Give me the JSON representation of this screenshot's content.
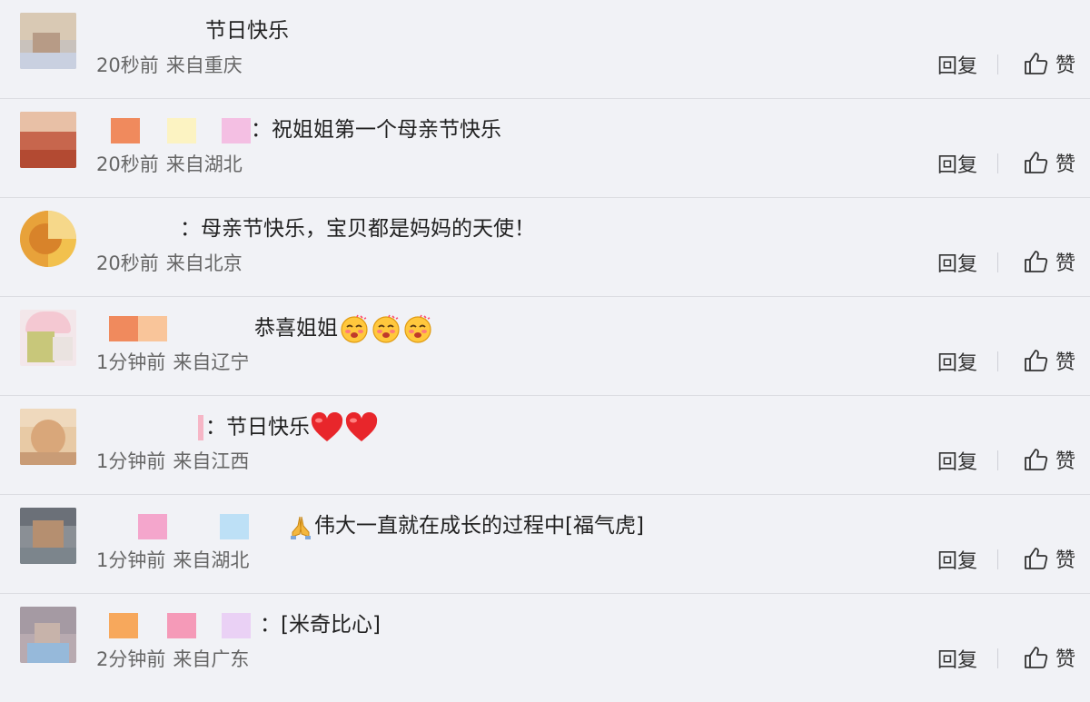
{
  "actions": {
    "reply_label": "回复",
    "like_label": "赞"
  },
  "comments": [
    {
      "text": "节日快乐",
      "time": "20秒前",
      "location": "来自重庆"
    },
    {
      "text": "：祝姐姐第一个母亲节快乐",
      "time": "20秒前",
      "location": "来自湖北"
    },
    {
      "text": "：母亲节快乐，宝贝都是妈妈的天使！",
      "time": "20秒前",
      "location": "来自北京"
    },
    {
      "text": "恭喜姐姐",
      "time": "1分钟前",
      "location": "来自辽宁"
    },
    {
      "text": "：节日快乐",
      "time": "1分钟前",
      "location": "来自江西"
    },
    {
      "text": "伟大一直就在成长的过程中[福气虎]",
      "time": "1分钟前",
      "location": "来自湖北"
    },
    {
      "text": "：[米奇比心]",
      "time": "2分钟前",
      "location": "来自广东"
    }
  ],
  "icons": {
    "like": "thumbs-up-icon",
    "heart": "heart-icon",
    "pray": "praying-hands-icon",
    "smile": "blushing-face-icon"
  }
}
